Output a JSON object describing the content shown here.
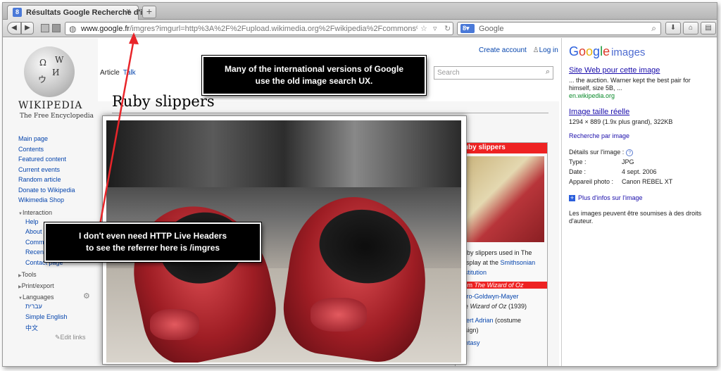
{
  "browser": {
    "tab_title": "Résultats Google Recherche d'i...",
    "tab_close": "×",
    "new_tab": "+",
    "url_host": "www.google.fr",
    "url_path": "/imgres?imgurl=http%3A%2F%2Fupload.wikimedia.org%2Fwikipedia%2Fcommons%2Fb%2Fbb%2",
    "search_engine_value": "Google",
    "icons": [
      "back-icon",
      "forward-icon",
      "globe-icon",
      "star-icon",
      "reload-icon",
      "search-icon",
      "download-icon",
      "home-icon",
      "menu-icon"
    ]
  },
  "wikipedia": {
    "wordmark": "WIKIPEDIA",
    "tagline": "The Free Encyclopedia",
    "create_account": "Create account",
    "log_in": "Log in",
    "tab_article": "Article",
    "tab_talk": "Talk",
    "search_placeholder": "Search",
    "heading": "Ruby slippers",
    "nav_items": [
      "Main page",
      "Contents",
      "Featured content",
      "Current events",
      "Random article",
      "Donate to Wikipedia",
      "Wikimedia Shop"
    ],
    "interaction_label": "Interaction",
    "interaction_items": [
      "Help",
      "About W",
      "Commu",
      "Recent",
      "Contact page"
    ],
    "tools_label": "Tools",
    "print_label": "Print/export",
    "languages_label": "Languages",
    "language_items": [
      "עברית",
      "Simple English",
      "中文"
    ],
    "edit_links": "Edit links",
    "infobox_header": "ruby slippers",
    "infobox_caption_1": "ruby slippers used in The",
    "infobox_caption_2": "display at the ",
    "infobox_caption_link1": "Smithsonian",
    "infobox_caption_link2": "nstitution",
    "infobox_from": "from ",
    "infobox_from_link": "The Wizard of Oz",
    "infobox_studio": "etro-Goldwyn-Mayer",
    "infobox_film_1": "he ",
    "infobox_film_2": "Wizard of Oz",
    "infobox_film_3": " (1939)",
    "infobox_designer": "lbert Adrian",
    "infobox_designer_2": " (costume",
    "infobox_design": "esign)",
    "infobox_genre": "antasy"
  },
  "lightbox": {
    "close": "×",
    "image_desc": "ruby-slippers-photo"
  },
  "google_panel": {
    "logo_g": "G",
    "logo_o1": "o",
    "logo_o2": "o",
    "logo_g2": "g",
    "logo_l": "l",
    "logo_e": "e",
    "logo_images": "images",
    "site_link": "Site Web pour cette image",
    "snippet_1": "... the auction. Warner kept the best pair for",
    "snippet_2": "himself, size 5B, ...",
    "site_url": "en.wikipedia.org",
    "full_size_link": "Image taille réelle",
    "size_info": "1294 × 889 (1.9x plus grand), 322KB",
    "search_by_image": "Recherche par image",
    "details_label": "Détails sur l'image :",
    "help": "?",
    "type_label": "Type :",
    "type_value": "JPG",
    "date_label": "Date :",
    "date_value": "4 sept. 2006",
    "camera_label": "Appareil photo :",
    "camera_value": "Canon REBEL XT",
    "more_info": "Plus d'infos sur l'image",
    "plus": "+",
    "rights_1": "Les images peuvent être soumises à des droits",
    "rights_2": "d'auteur."
  },
  "annotations": {
    "callout_top_1": "Many of the international versions of Google",
    "callout_top_2": "use the old image search UX.",
    "callout_bottom_1": "I don't even need HTTP Live Headers",
    "callout_bottom_2": "to see the referrer here is /imgres",
    "arrow_color": "#e8252a"
  }
}
